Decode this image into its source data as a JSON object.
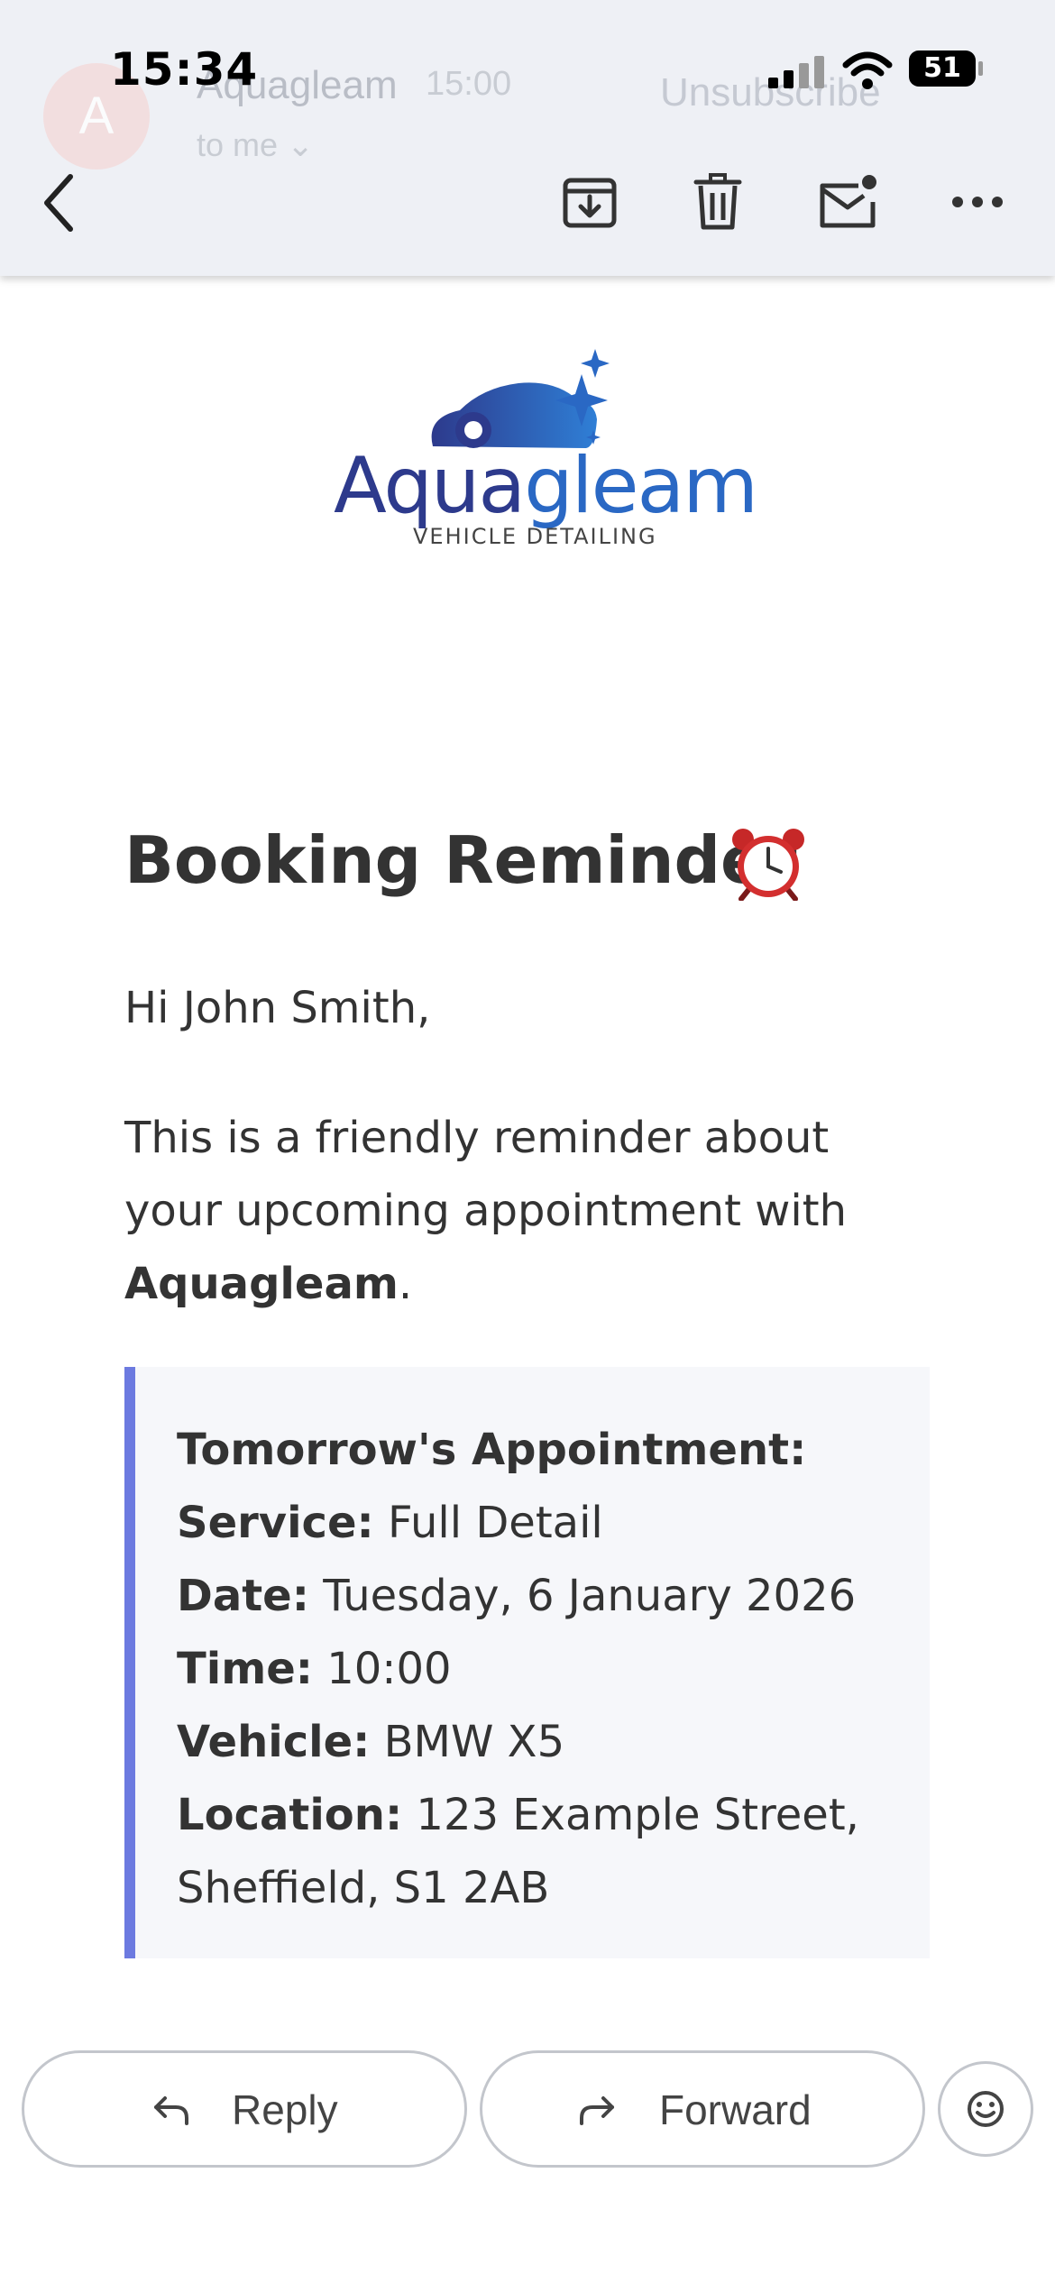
{
  "status_bar": {
    "time": "15:34",
    "battery": "51"
  },
  "ghost_header": {
    "avatar_letter": "A",
    "sender": "Aquagleam",
    "time": "15:00",
    "to": "to me ⌄",
    "unsubscribe": "Unsubscribe"
  },
  "toolbar": {
    "back_icon": "chevron-left-icon",
    "archive_icon": "archive-icon",
    "delete_icon": "trash-icon",
    "unread_icon": "mark-unread-icon",
    "more_icon": "more-horizontal-icon"
  },
  "logo": {
    "brand_part1": "Aqua",
    "brand_part2": "gleam",
    "tagline": "VEHICLE DETAILING"
  },
  "email": {
    "title": "Booking Reminder",
    "title_icon": "alarm-clock-icon",
    "greeting": "Hi John Smith,",
    "intro_before": "This is a friendly reminder about your upcoming appointment with ",
    "intro_brand": "Aquagleam",
    "intro_after": ".",
    "details": {
      "heading": "Tomorrow's Appointment:",
      "service_label": "Service:",
      "service_value": " Full Detail",
      "date_label": "Date:",
      "date_value": " Tuesday, 6 January 2026",
      "time_label": "Time:",
      "time_value": " 10:00",
      "vehicle_label": "Vehicle:",
      "vehicle_value": " BMW X5",
      "location_label": "Location:",
      "location_value_line1": " 123 Example Street,",
      "location_value_line2": "Sheffield, S1 2AB"
    }
  },
  "actions": {
    "reply": "Reply",
    "forward": "Forward",
    "emoji_icon": "smiley-icon"
  },
  "colors": {
    "accent_bar": "#6c7ae0",
    "brand_dark": "#2d3a8c",
    "brand_light": "#2a68c4",
    "header_bg": "#eef0f5"
  }
}
